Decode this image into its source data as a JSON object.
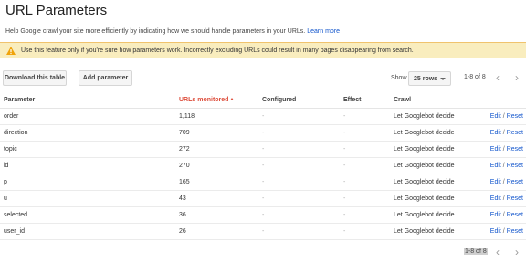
{
  "title": "URL Parameters",
  "intro": {
    "text": "Help Google crawl your site more efficiently by indicating how we should handle parameters in your URLs.",
    "link": "Learn more"
  },
  "warning": {
    "text": "Use this feature only if you're sure how parameters work. Incorrectly excluding URLs could result in many pages disappearing from search.",
    "icon": "warning-icon"
  },
  "toolbar": {
    "download_label": "Download this table",
    "add_label": "Add parameter",
    "show_label": "Show",
    "rows_value": "25 rows",
    "range": "1-8 of 8",
    "prev_glyph": "‹",
    "next_glyph": "›"
  },
  "table": {
    "headers": {
      "parameter": "Parameter",
      "urls": "URLs monitored",
      "configured": "Configured",
      "effect": "Effect",
      "crawl": "Crawl"
    },
    "rows": [
      {
        "param": "order",
        "urls": "1,118",
        "configured": "-",
        "effect": "-",
        "crawl": "Let Googlebot decide",
        "edit": "Edit",
        "sep": " / ",
        "reset": "Reset"
      },
      {
        "param": "direction",
        "urls": "709",
        "configured": "-",
        "effect": "-",
        "crawl": "Let Googlebot decide",
        "edit": "Edit",
        "sep": " / ",
        "reset": "Reset"
      },
      {
        "param": "topic",
        "urls": "272",
        "configured": "-",
        "effect": "-",
        "crawl": "Let Googlebot decide",
        "edit": "Edit",
        "sep": " / ",
        "reset": "Reset"
      },
      {
        "param": "id",
        "urls": "270",
        "configured": "-",
        "effect": "-",
        "crawl": "Let Googlebot decide",
        "edit": "Edit",
        "sep": " / ",
        "reset": "Reset"
      },
      {
        "param": "p",
        "urls": "165",
        "configured": "-",
        "effect": "-",
        "crawl": "Let Googlebot decide",
        "edit": "Edit",
        "sep": " / ",
        "reset": "Reset"
      },
      {
        "param": "u",
        "urls": "43",
        "configured": "-",
        "effect": "-",
        "crawl": "Let Googlebot decide",
        "edit": "Edit",
        "sep": " / ",
        "reset": "Reset"
      },
      {
        "param": "selected",
        "urls": "36",
        "configured": "-",
        "effect": "-",
        "crawl": "Let Googlebot decide",
        "edit": "Edit",
        "sep": " / ",
        "reset": "Reset"
      },
      {
        "param": "user_id",
        "urls": "26",
        "configured": "-",
        "effect": "-",
        "crawl": "Let Googlebot decide",
        "edit": "Edit",
        "sep": " / ",
        "reset": "Reset"
      }
    ]
  },
  "footer": {
    "range": "1-8 of 8"
  },
  "colors": {
    "link": "#1155cc",
    "sorted_header": "#dd4b39",
    "warning_bg": "#f9edbe"
  }
}
